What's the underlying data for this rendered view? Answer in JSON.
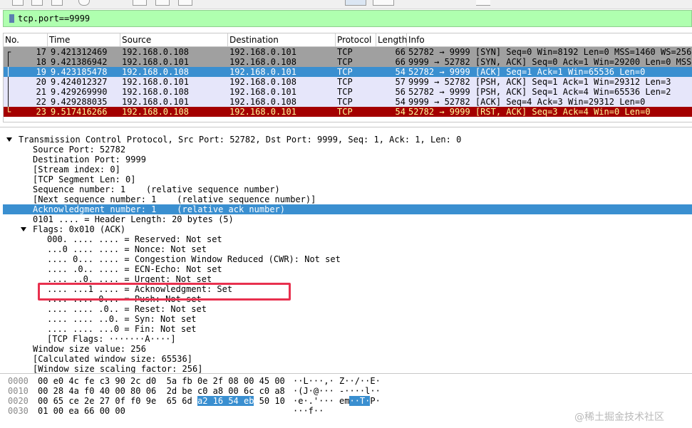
{
  "filter": {
    "value": "tcp.port==9999"
  },
  "packet_list": {
    "columns": [
      "No.",
      "Time",
      "Source",
      "Destination",
      "Protocol",
      "Length",
      "Info"
    ],
    "rows": [
      {
        "no": "17",
        "time": "9.421312469",
        "src": "192.168.0.108",
        "dst": "192.168.0.101",
        "proto": "TCP",
        "len": "66",
        "info": "52782 → 9999 [SYN] Seq=0 Win=8192 Len=0 MSS=1460 WS=256",
        "marker": "┌",
        "bg": "#a0a0a0",
        "fg": "#000000"
      },
      {
        "no": "18",
        "time": "9.421386942",
        "src": "192.168.0.101",
        "dst": "192.168.0.108",
        "proto": "TCP",
        "len": "66",
        "info": "9999 → 52782 [SYN, ACK] Seq=0 Ack=1 Win=29200 Len=0 MSS",
        "marker": "│",
        "bg": "#a0a0a0",
        "fg": "#000000"
      },
      {
        "no": "19",
        "time": "9.423185478",
        "src": "192.168.0.108",
        "dst": "192.168.0.101",
        "proto": "TCP",
        "len": "54",
        "info": "52782 → 9999 [ACK] Seq=1 Ack=1 Win=65536 Len=0",
        "marker": "│",
        "bg": "#3a8fd0",
        "fg": "#ffffff"
      },
      {
        "no": "20",
        "time": "9.424012327",
        "src": "192.168.0.101",
        "dst": "192.168.0.108",
        "proto": "TCP",
        "len": "57",
        "info": "9999 → 52782 [PSH, ACK] Seq=1 Ack=1 Win=29312 Len=3",
        "marker": "│",
        "bg": "#e6e6fa",
        "fg": "#000000"
      },
      {
        "no": "21",
        "time": "9.429269990",
        "src": "192.168.0.108",
        "dst": "192.168.0.101",
        "proto": "TCP",
        "len": "56",
        "info": "52782 → 9999 [PSH, ACK] Seq=1 Ack=4 Win=65536 Len=2",
        "marker": "│",
        "bg": "#e6e6fa",
        "fg": "#000000"
      },
      {
        "no": "22",
        "time": "9.429288035",
        "src": "192.168.0.101",
        "dst": "192.168.0.108",
        "proto": "TCP",
        "len": "54",
        "info": "9999 → 52782 [ACK] Seq=4 Ack=3 Win=29312 Len=0",
        "marker": "│",
        "bg": "#e6e6fa",
        "fg": "#000000"
      },
      {
        "no": "23",
        "time": "9.517416266",
        "src": "192.168.0.108",
        "dst": "192.168.0.101",
        "proto": "TCP",
        "len": "54",
        "info": "52782 → 9999 [RST, ACK] Seq=3 Ack=4 Win=0 Len=0",
        "marker": "└",
        "bg": "#a40000",
        "fg": "#fffc9c"
      }
    ]
  },
  "details": [
    {
      "indent": 0,
      "expander": "open",
      "text": "Transmission Control Protocol, Src Port: 52782, Dst Port: 9999, Seq: 1, Ack: 1, Len: 0"
    },
    {
      "indent": 1,
      "text": "Source Port: 52782"
    },
    {
      "indent": 1,
      "text": "Destination Port: 9999"
    },
    {
      "indent": 1,
      "text": "[Stream index: 0]"
    },
    {
      "indent": 1,
      "text": "[TCP Segment Len: 0]"
    },
    {
      "indent": 1,
      "text": "Sequence number: 1    (relative sequence number)"
    },
    {
      "indent": 1,
      "text": "[Next sequence number: 1    (relative sequence number)]"
    },
    {
      "indent": 1,
      "text": "Acknowledgment number: 1    (relative ack number)",
      "selected": true
    },
    {
      "indent": 1,
      "text": "0101 .... = Header Length: 20 bytes (5)"
    },
    {
      "indent": 1,
      "expander": "open",
      "text": "Flags: 0x010 (ACK)"
    },
    {
      "indent": 2,
      "text": "000. .... .... = Reserved: Not set"
    },
    {
      "indent": 2,
      "text": "...0 .... .... = Nonce: Not set"
    },
    {
      "indent": 2,
      "text": ".... 0... .... = Congestion Window Reduced (CWR): Not set"
    },
    {
      "indent": 2,
      "text": ".... .0.. .... = ECN-Echo: Not set"
    },
    {
      "indent": 2,
      "text": ".... ..0. .... = Urgent: Not set"
    },
    {
      "indent": 2,
      "text": ".... ...1 .... = Acknowledgment: Set"
    },
    {
      "indent": 2,
      "text": ".... .... 0... = Push: Not set"
    },
    {
      "indent": 2,
      "text": ".... .... .0.. = Reset: Not set"
    },
    {
      "indent": 2,
      "text": ".... .... ..0. = Syn: Not set"
    },
    {
      "indent": 2,
      "text": ".... .... ...0 = Fin: Not set"
    },
    {
      "indent": 2,
      "text": "[TCP Flags: ·······A····]"
    },
    {
      "indent": 1,
      "text": "Window size value: 256"
    },
    {
      "indent": 1,
      "text": "[Calculated window size: 65536]"
    },
    {
      "indent": 1,
      "text": "[Window size scaling factor: 256]"
    }
  ],
  "hex": [
    {
      "offset": "0000",
      "pre": "00 e0 4c fe c3 90 2c d0  5a fb 0e 2f 08 00 45 00",
      "sel": "",
      "post": "",
      "ascii_pre": "··L···,· Z··/··E·",
      "ascii_sel": "",
      "ascii_post": ""
    },
    {
      "offset": "0010",
      "pre": "00 28 4a f0 40 00 80 06  2d be c0 a8 00 6c c0 a8",
      "sel": "",
      "post": "",
      "ascii_pre": "·(J·@··· -····l··",
      "ascii_sel": "",
      "ascii_post": ""
    },
    {
      "offset": "0020",
      "pre": "00 65 ce 2e 27 0f f0 9e  65 6d ",
      "sel": "a2 16 54 eb",
      "post": " 50 10",
      "ascii_pre": "·e·.'··· em",
      "ascii_sel": "··T·",
      "ascii_post": "P·"
    },
    {
      "offset": "0030",
      "pre": "01 00 ea 66 00 00",
      "sel": "",
      "post": "",
      "ascii_pre": "···f··",
      "ascii_sel": "",
      "ascii_post": ""
    }
  ],
  "watermark": "@稀土掘金技术社区",
  "colors": {
    "selected": "#3a8fd0",
    "filter_ok": "#afffaf",
    "annotation": "#e8304e",
    "rst_row": "#a40000"
  }
}
